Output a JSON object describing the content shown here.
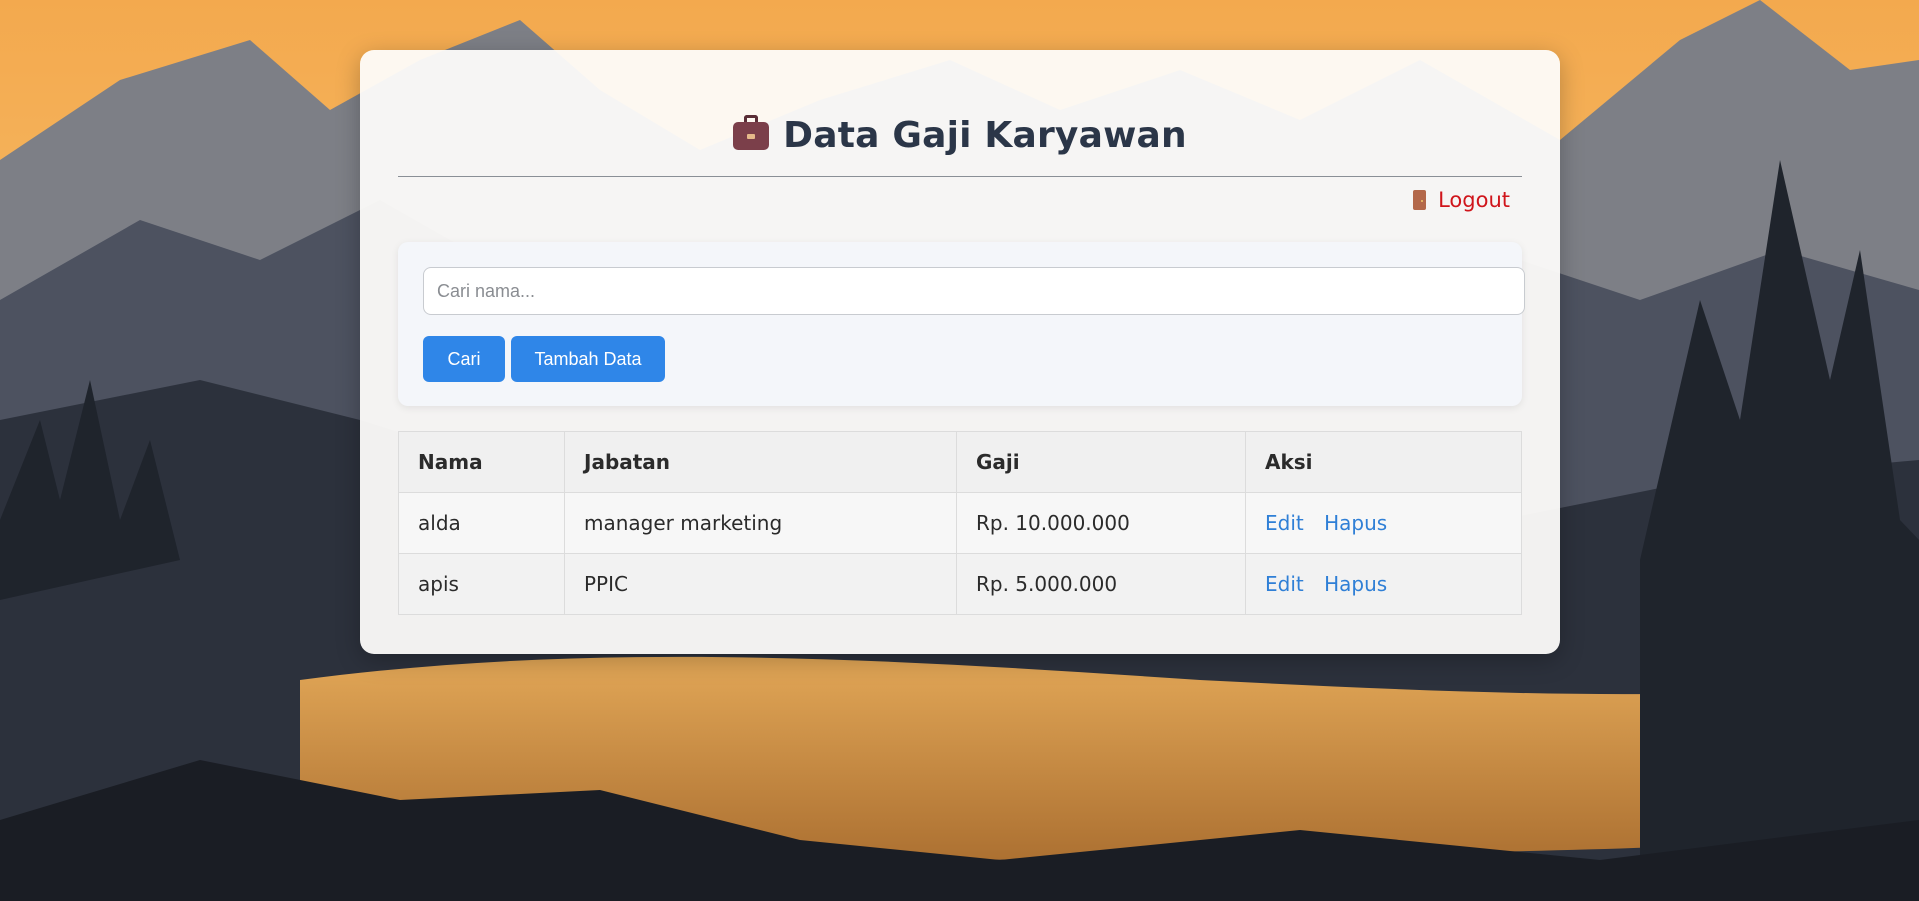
{
  "header": {
    "title": "Data Gaji Karyawan",
    "title_icon": "briefcase-icon",
    "logout_label": "Logout",
    "logout_icon": "door-icon",
    "logout_color": "#d0151b"
  },
  "search": {
    "placeholder": "Cari nama...",
    "value": "",
    "search_button_label": "Cari",
    "add_button_label": "Tambah Data",
    "button_color": "#2f86e8"
  },
  "table": {
    "headers": [
      "Nama",
      "Jabatan",
      "Gaji",
      "Aksi"
    ],
    "rows": [
      {
        "nama": "alda",
        "jabatan": "manager marketing",
        "gaji": "Rp. 10.000.000",
        "edit": "Edit",
        "hapus": "Hapus"
      },
      {
        "nama": "apis",
        "jabatan": "PPIC",
        "gaji": "Rp. 5.000.000",
        "edit": "Edit",
        "hapus": "Hapus"
      }
    ],
    "link_color": "#2f7fd6"
  }
}
